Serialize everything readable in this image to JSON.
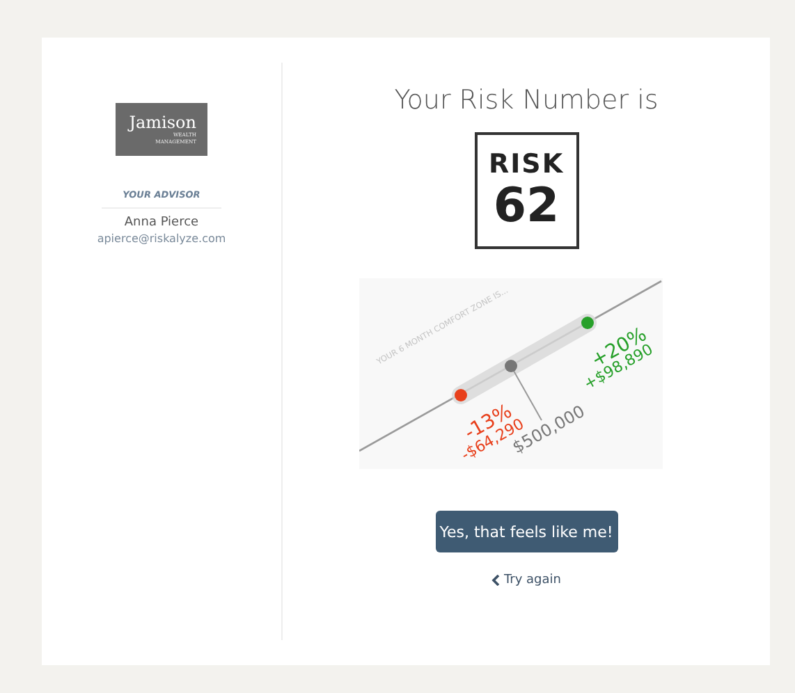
{
  "sidebar": {
    "logo": {
      "name": "Jamison",
      "line_1": "WEALTH",
      "line_2": "MANAGEMENT"
    },
    "advisor_label": "YOUR ADVISOR",
    "advisor_name": "Anna Pierce",
    "advisor_email": "apierce@riskalyze.com"
  },
  "main": {
    "heading": "Your Risk Number is",
    "sign": {
      "word": "RISK",
      "number": "62"
    },
    "comfort_zone": {
      "caption": "YOUR 6 MONTH COMFORT ZONE IS...",
      "low": {
        "percent": "-13%",
        "amount": "-$64,290"
      },
      "center": {
        "amount": "$500,000"
      },
      "high": {
        "percent": "+20%",
        "amount": "+$98,890"
      }
    },
    "confirm_button": "Yes, that feels like me!",
    "back_link": "Try again"
  }
}
